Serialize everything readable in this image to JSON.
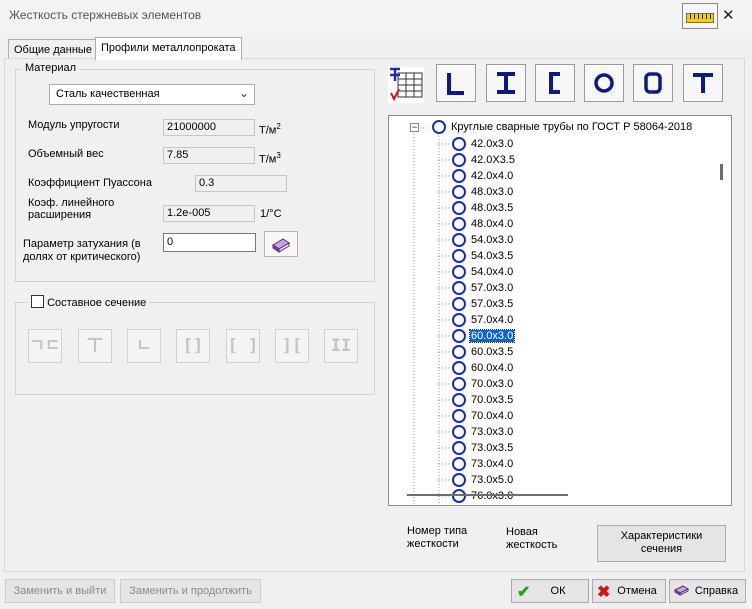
{
  "window": {
    "title": "Жесткость стержневых элементов",
    "close": "✕"
  },
  "tabs": [
    {
      "label": "Общие данные",
      "active": false
    },
    {
      "label": "Профили металлопроката",
      "active": true
    }
  ],
  "material": {
    "group_label": "Материал",
    "selected": "Сталь качественная",
    "modulus": {
      "label": "Модуль упругости",
      "value": "21000000",
      "unit_base": "Т/м",
      "unit_sup": "2"
    },
    "weight": {
      "label": "Объемный вес",
      "value": "7.85",
      "unit_base": "Т/м",
      "unit_sup": "3"
    },
    "poisson": {
      "label": "Коэффициент Пуассона",
      "value": "0.3"
    },
    "expansion": {
      "label_line1": "Коэф. линейного",
      "label_line2": "расширения",
      "value": "1.2e-005",
      "unit": "1/°C"
    },
    "damping": {
      "label_line1": "Параметр затухания (в",
      "label_line2": "долях от критического)",
      "value": "0"
    }
  },
  "composite": {
    "label": "Составное сечение",
    "checked": false
  },
  "composite_buttons": [
    "ㄱㄷ",
    "ㄒ",
    "ㄴ",
    "[]",
    "[ ]",
    "][",
    "II"
  ],
  "profile_buttons": [
    "L",
    "I",
    "[",
    "O",
    "O",
    "T"
  ],
  "tree": {
    "root_label": "Круглые сварные трубы по ГОСТ Р 58064-2018",
    "items": [
      "42.0x3.0",
      "42.0X3.5",
      "42.0x4.0",
      "48.0x3.0",
      "48.0x3.5",
      "48.0x4.0",
      "54.0x3.0",
      "54.0x3.5",
      "54.0x4.0",
      "57.0x3.0",
      "57.0x3.5",
      "57.0x4.0",
      "60.0x3.0",
      "60.0x3.5",
      "60.0x4.0",
      "70.0x3.0",
      "70.0x3.5",
      "70.0x4.0",
      "73.0x3.0",
      "73.0x3.5",
      "73.0x4.0",
      "73.0x5.0",
      "76.0x3.0"
    ],
    "selected_index": 12
  },
  "bottom_labels": {
    "type_number_line1": "Номер типа",
    "type_number_line2": "жесткости",
    "new_line1": "Новая",
    "new_line2": "жесткость"
  },
  "buttons": {
    "characteristics_line1": "Характеристики",
    "characteristics_line2": "сечения",
    "replace_exit": "Заменить и выйти",
    "replace_continue": "Заменить и продолжить",
    "ok": "ОК",
    "cancel": "Отмена",
    "help": "Справка"
  },
  "colors": {
    "accent_blue": "#1b2fa8",
    "selection": "#0b66c6",
    "ok_green": "#1aa41a",
    "cancel_red": "#c81818"
  },
  "icons": {
    "help": "book-icon",
    "ok": "check-icon",
    "cancel": "cross-icon"
  }
}
